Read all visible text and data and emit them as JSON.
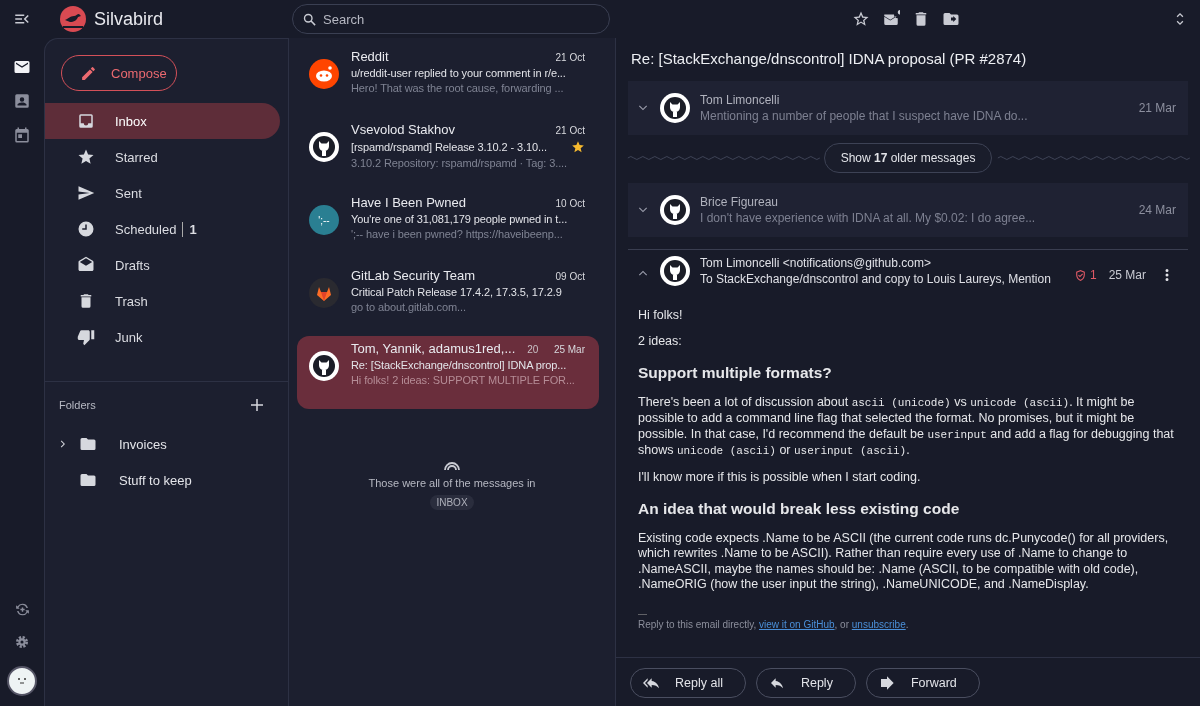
{
  "app": {
    "name": "Silvabird"
  },
  "rail": [
    {
      "kind": "mail",
      "selected": true
    },
    {
      "kind": "contacts",
      "selected": false
    },
    {
      "kind": "calendar",
      "selected": false
    }
  ],
  "search": {
    "placeholder": "Search"
  },
  "compose": {
    "label": "Compose"
  },
  "mailboxes": [
    {
      "kind": "inbox",
      "label": "Inbox",
      "selected": true
    },
    {
      "kind": "starred",
      "label": "Starred",
      "selected": false
    },
    {
      "kind": "sent",
      "label": "Sent",
      "selected": false
    },
    {
      "kind": "scheduled",
      "label": "Scheduled",
      "count": "1",
      "selected": false
    },
    {
      "kind": "drafts",
      "label": "Drafts",
      "selected": false
    },
    {
      "kind": "trash",
      "label": "Trash",
      "selected": false
    },
    {
      "kind": "junk",
      "label": "Junk",
      "selected": false
    }
  ],
  "folders": {
    "title": "Folders",
    "items": [
      {
        "label": "Invoices",
        "expandable": true
      },
      {
        "label": "Stuff to keep",
        "expandable": false
      }
    ]
  },
  "messages": [
    {
      "kind": "reddit",
      "sender": "Reddit",
      "date": "21 Oct",
      "subject": "u/reddit-user replied to your comment in r/e...",
      "preview": "Hero! That was the root cause, forwarding ...",
      "starred": false,
      "selected": false
    },
    {
      "kind": "github",
      "sender": "Vsevolod Stakhov",
      "date": "21 Oct",
      "subject": "[rspamd/rspamd] Release 3.10.2 - 3.10...",
      "preview": "3.10.2 Repository: rspamd/rspamd · Tag: 3....",
      "starred": true,
      "selected": false
    },
    {
      "kind": "text",
      "avatar_text": "';--",
      "sender": "Have I Been Pwned",
      "date": "10 Oct",
      "subject": "You're one of 31,081,179 people pwned in t...",
      "preview": "';-- have i been pwned? https://haveibeenp...",
      "starred": false,
      "selected": false
    },
    {
      "kind": "gitlab",
      "sender": "GitLab Security Team",
      "date": "09 Oct",
      "subject": "Critical Patch Release 17.4.2, 17.3.5, 17.2.9",
      "preview": "go to about.gitlab.com...",
      "starred": false,
      "selected": false
    },
    {
      "kind": "github",
      "sender": "Tom, Yannik, adamus1red,...",
      "count": "20",
      "date": "25 Mar",
      "subject": "Re: [StackExchange/dnscontrol] IDNA prop...",
      "preview": "Hi folks! 2 ideas: SUPPORT MULTIPLE FOR...",
      "starred": false,
      "selected": true
    }
  ],
  "list_end": {
    "text": "Those were all of the messages in",
    "mailbox": "INBOX"
  },
  "reader": {
    "subject": "Re: [StackExchange/dnscontrol] IDNA proposal (PR #2874)",
    "thread": [
      {
        "kind": "message",
        "expanded": false,
        "sender": "Tom Limoncelli",
        "snippet": "Mentioning a number of people that I suspect have IDNA do...",
        "date": "21 Mar"
      },
      {
        "kind": "older",
        "label": "Show **17** older messages"
      },
      {
        "kind": "message",
        "expanded": false,
        "sender": "Brice Figureau",
        "snippet": "I don't have experience with IDNA at all. My $0.02: I do agree...",
        "date": "24 Mar"
      },
      {
        "kind": "message",
        "expanded": true,
        "sender": "Tom Limoncelli <notifications@github.com>",
        "recipients": "To StackExchange/dnscontrol and copy to Louis Laureys, Mention",
        "flag_count": "1",
        "date": "25 Mar"
      }
    ],
    "body": [
      {
        "kind": "p",
        "parts": [
          {
            "kind": "text",
            "text": "Hi folks!"
          }
        ]
      },
      {
        "kind": "p",
        "parts": [
          {
            "kind": "text",
            "text": "2 ideas:"
          }
        ]
      },
      {
        "kind": "h",
        "text": "Support multiple formats?"
      },
      {
        "kind": "p",
        "parts": [
          {
            "kind": "text",
            "text": "There's been a lot of discussion about "
          },
          {
            "kind": "code",
            "text": "ascii (unicode)"
          },
          {
            "kind": "text",
            "text": " vs "
          },
          {
            "kind": "code",
            "text": "unicode (ascii)"
          },
          {
            "kind": "text",
            "text": ". It might be possible to add a command line flag that selected the format. No promises, but it might be possible. In that case, I'd recommend the default be "
          },
          {
            "kind": "code",
            "text": "userinput"
          },
          {
            "kind": "text",
            "text": " and add a flag for debugging that shows "
          },
          {
            "kind": "code",
            "text": "unicode (ascii)"
          },
          {
            "kind": "text",
            "text": " or "
          },
          {
            "kind": "code",
            "text": "userinput (ascii)"
          },
          {
            "kind": "text",
            "text": "."
          }
        ]
      },
      {
        "kind": "p",
        "parts": [
          {
            "kind": "text",
            "text": "I'll know more if this is possible when I start coding."
          }
        ]
      },
      {
        "kind": "h",
        "text": "An idea that would break less existing code"
      },
      {
        "kind": "p",
        "parts": [
          {
            "kind": "text",
            "text": "Existing code expects .Name to be ASCII (the current code runs dc.Punycode() for all providers, which rewrites .Name to be ASCII). Rather than require every use of .Name to change to .NameASCII, maybe the names should be: .Name (ASCII, to be compatible with old code), .NameORIG (how the user input the string), .NameUNICODE, and .NameDisplay."
          }
        ]
      },
      {
        "kind": "sig",
        "text": "—"
      },
      {
        "kind": "small",
        "parts": [
          {
            "kind": "text",
            "text": "Reply to this email directly, "
          },
          {
            "kind": "link",
            "text": "view it on GitHub"
          },
          {
            "kind": "text",
            "text": ", or "
          },
          {
            "kind": "link",
            "text": "unsubscribe"
          },
          {
            "kind": "text",
            "text": "."
          }
        ]
      }
    ],
    "actions": [
      {
        "kind": "reply_all",
        "label": "Reply all"
      },
      {
        "kind": "reply",
        "label": "Reply"
      },
      {
        "kind": "forward",
        "label": "Forward"
      }
    ]
  }
}
